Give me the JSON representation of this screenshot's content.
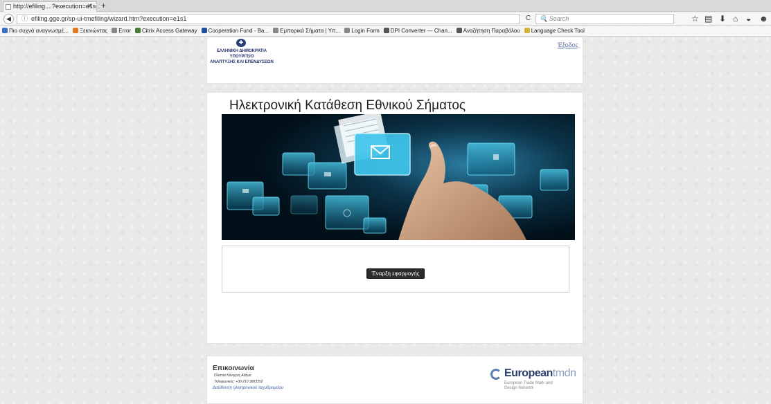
{
  "browser": {
    "tab_title": "http://efiling....?execution=e1s1",
    "tab_close": "✕",
    "new_tab": "+",
    "url": "efiling.gge.gr/sp-ui-tmefiling/wizard.htm?execution=e1s1",
    "search_placeholder": "Search",
    "bookmarks": [
      {
        "label": "Πιο συχνά αναγνωσμέ...",
        "color": "#3b6fc2"
      },
      {
        "label": "Ξεκινώντας",
        "color": "#e07a1e"
      },
      {
        "label": "Error",
        "color": "#888888"
      },
      {
        "label": "Citrix Access Gateway",
        "color": "#4a7a3a"
      },
      {
        "label": "Cooperation Fund - Ba...",
        "color": "#1d4f9c"
      },
      {
        "label": "Εμπορικά Σήματα | Υπ...",
        "color": "#888888"
      },
      {
        "label": "Login Form",
        "color": "#888888"
      },
      {
        "label": "DPI Converter — Chan...",
        "color": "#555555"
      },
      {
        "label": "Αναζήτηση Παραβόλου",
        "color": "#555555"
      },
      {
        "label": "Language Check Tool",
        "color": "#d6b23a"
      }
    ]
  },
  "header": {
    "gov_line1": "ΕΛΛΗΝΙΚΗ ΔΗΜΟΚΡΑΤΙΑ",
    "gov_line2": "ΥΠΟΥΡΓΕΙΟ",
    "gov_line3": "ΑΝΑΠΤΥΞΗΣ ΚΑΙ ΕΠΕΝΔΥΣΕΩΝ",
    "logout": "Έξοδος"
  },
  "main": {
    "title": "Ηλεκτρονική Κατάθεση Εθνικού Σήματος",
    "start_button": "Έναρξη εφαρμογής"
  },
  "footer": {
    "contact_title": "Επικοινωνία",
    "address": "Πλατεία Κάνιγγος Αθήνα",
    "phone": "Τηλεφωνικός: +30 210 3893352",
    "email_link": "Διεύθυνση ηλεκτρονικού ταχυδρομείου",
    "logo_main": "European",
    "logo_thin": "tmdn",
    "logo_sub": "European Trade Mark and Design Network"
  }
}
